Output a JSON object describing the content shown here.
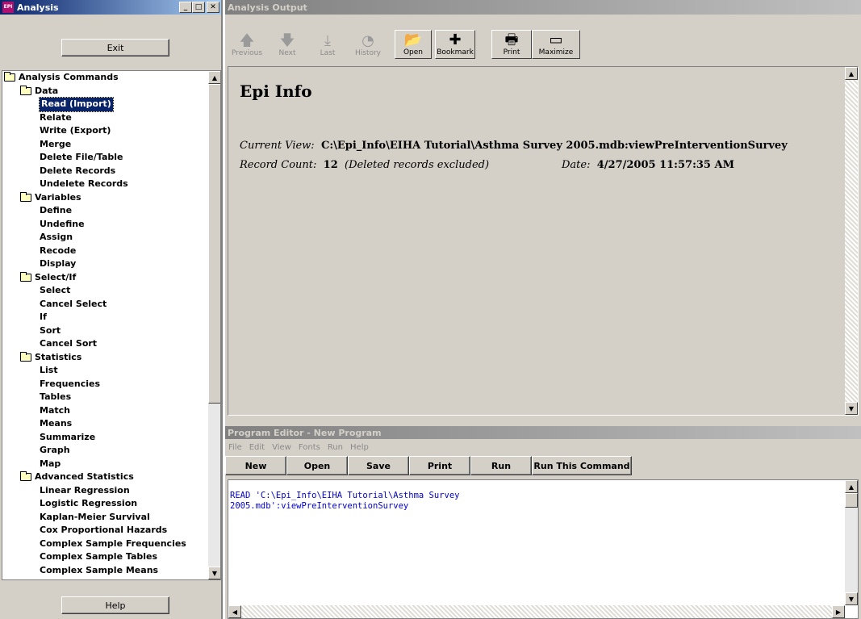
{
  "left_window": {
    "title": "Analysis",
    "exit_label": "Exit",
    "help_label": "Help",
    "tree": [
      {
        "level": 0,
        "folder": true,
        "label": "Analysis Commands"
      },
      {
        "level": 1,
        "folder": true,
        "label": "Data"
      },
      {
        "level": 2,
        "label": "Read (Import)",
        "selected": true
      },
      {
        "level": 2,
        "label": "Relate"
      },
      {
        "level": 2,
        "label": "Write (Export)"
      },
      {
        "level": 2,
        "label": "Merge"
      },
      {
        "level": 2,
        "label": "Delete File/Table"
      },
      {
        "level": 2,
        "label": "Delete Records"
      },
      {
        "level": 2,
        "label": "Undelete Records"
      },
      {
        "level": 1,
        "folder": true,
        "label": "Variables"
      },
      {
        "level": 2,
        "label": "Define"
      },
      {
        "level": 2,
        "label": "Undefine"
      },
      {
        "level": 2,
        "label": "Assign"
      },
      {
        "level": 2,
        "label": "Recode"
      },
      {
        "level": 2,
        "label": "Display"
      },
      {
        "level": 1,
        "folder": true,
        "label": "Select/If"
      },
      {
        "level": 2,
        "label": "Select"
      },
      {
        "level": 2,
        "label": "Cancel Select"
      },
      {
        "level": 2,
        "label": "If"
      },
      {
        "level": 2,
        "label": "Sort"
      },
      {
        "level": 2,
        "label": "Cancel Sort"
      },
      {
        "level": 1,
        "folder": true,
        "label": "Statistics"
      },
      {
        "level": 2,
        "label": "List"
      },
      {
        "level": 2,
        "label": "Frequencies"
      },
      {
        "level": 2,
        "label": "Tables"
      },
      {
        "level": 2,
        "label": "Match"
      },
      {
        "level": 2,
        "label": "Means"
      },
      {
        "level": 2,
        "label": "Summarize"
      },
      {
        "level": 2,
        "label": "Graph"
      },
      {
        "level": 2,
        "label": "Map"
      },
      {
        "level": 1,
        "folder": true,
        "label": "Advanced Statistics"
      },
      {
        "level": 2,
        "label": "Linear Regression"
      },
      {
        "level": 2,
        "label": "Logistic Regression"
      },
      {
        "level": 2,
        "label": "Kaplan-Meier Survival"
      },
      {
        "level": 2,
        "label": "Cox Proportional Hazards"
      },
      {
        "level": 2,
        "label": "Complex Sample Frequencies"
      },
      {
        "level": 2,
        "label": "Complex Sample Tables"
      },
      {
        "level": 2,
        "label": "Complex Sample Means"
      }
    ]
  },
  "output_window": {
    "title": "Analysis Output",
    "toolbar": [
      {
        "label": "Previous",
        "icon": "up-arrow-icon",
        "glyph": "🡅",
        "disabled": true
      },
      {
        "label": "Next",
        "icon": "down-arrow-icon",
        "glyph": "🡇",
        "disabled": true
      },
      {
        "label": "Last",
        "icon": "last-arrow-icon",
        "glyph": "⤓",
        "disabled": true
      },
      {
        "label": "History",
        "icon": "history-icon",
        "glyph": "◔",
        "disabled": true
      },
      {
        "label": "Open",
        "icon": "open-folder-icon",
        "glyph": "📂",
        "disabled": false
      },
      {
        "label": "Bookmark",
        "icon": "bookmark-icon",
        "glyph": "✚",
        "disabled": false
      },
      {
        "label": "Print",
        "icon": "printer-icon",
        "glyph": "🖶",
        "disabled": false
      },
      {
        "label": "Maximize",
        "icon": "maximize-icon",
        "glyph": "▭",
        "disabled": false
      }
    ],
    "heading": "Epi Info",
    "current_view_label": "Current View:",
    "current_view_value": "C:\\Epi_Info\\EIHA Tutorial\\Asthma Survey 2005.mdb:viewPreInterventionSurvey",
    "record_count_label": "Record Count:",
    "record_count_value": "12",
    "record_count_note": "(Deleted records excluded)",
    "date_label": "Date:",
    "date_value": "4/27/2005 11:57:35 AM"
  },
  "program_editor": {
    "title": "Program Editor - New Program",
    "menu": [
      "File",
      "Edit",
      "View",
      "Fonts",
      "Run",
      "Help"
    ],
    "buttons": [
      "New",
      "Open",
      "Save",
      "Print",
      "Run",
      "Run This Command"
    ],
    "code_line1": "READ 'C:\\Epi_Info\\EIHA Tutorial\\Asthma Survey",
    "code_line2": "2005.mdb':viewPreInterventionSurvey"
  }
}
